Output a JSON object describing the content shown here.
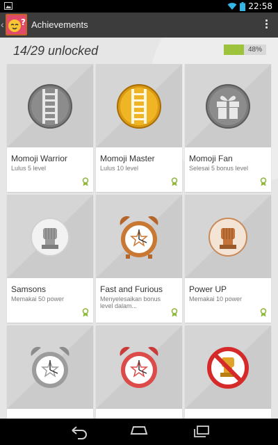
{
  "status_bar": {
    "time": "22:58"
  },
  "action_bar": {
    "title": "Achievements"
  },
  "summary": {
    "unlocked_text": "14/29 unlocked",
    "percent_text": "48%",
    "percent": 48
  },
  "achievements": [
    {
      "name": "Momoji Warrior",
      "desc": "Lulus 5 level",
      "icon": "ladder-gray-icon"
    },
    {
      "name": "Momoji Master",
      "desc": "Lulus 10 level",
      "icon": "ladder-gold-icon"
    },
    {
      "name": "Momoji Fan",
      "desc": "Selesai 5 bonus level",
      "icon": "gift-icon"
    },
    {
      "name": "Samsons",
      "desc": "Memakai 50 power",
      "icon": "fist-silver-icon"
    },
    {
      "name": "Fast and Furious",
      "desc": "Menyelesaikan bonus level dalam...",
      "icon": "alarm-clock-bronze-icon"
    },
    {
      "name": "Power UP",
      "desc": "Memakai 10 power",
      "icon": "fist-bronze-icon"
    },
    {
      "name": "",
      "desc": "",
      "icon": "alarm-clock-silver-icon"
    },
    {
      "name": "",
      "desc": "",
      "icon": "alarm-clock-red-icon"
    },
    {
      "name": "",
      "desc": "",
      "icon": "no-fist-gold-icon"
    }
  ]
}
